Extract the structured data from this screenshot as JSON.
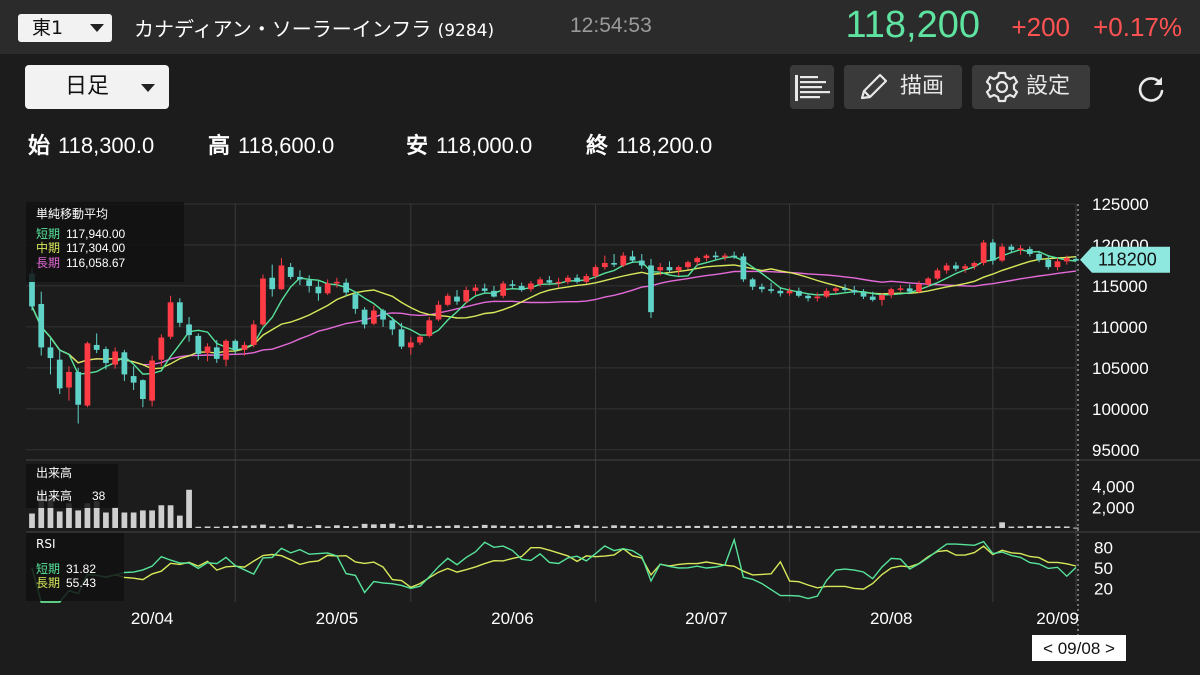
{
  "header": {
    "market": "東1",
    "stock_name": "カナディアン・ソーラーインフラ",
    "stock_code": "(9284)",
    "time": "12:54:53",
    "price": "118,200",
    "change": "+200",
    "change_pct": "+0.17%"
  },
  "toolbar": {
    "period": "日足",
    "draw_label": "描画",
    "settings_label": "設定",
    "icons": [
      "list-icon",
      "pencil-icon",
      "gear-icon",
      "refresh-icon"
    ]
  },
  "ohlc": {
    "open_label": "始",
    "open": "118,300.0",
    "high_label": "高",
    "high": "118,600.0",
    "low_label": "安",
    "low": "118,000.0",
    "close_label": "終",
    "close": "118,200.0"
  },
  "colors": {
    "up": "#ff3b46",
    "down": "#5fd3c8",
    "ma_short": "#56e39a",
    "ma_mid": "#d7e85a",
    "ma_long": "#e36ad8",
    "rsi_short": "#56e39a",
    "rsi_long": "#d7e85a",
    "price_tag": "#8fe8e0"
  },
  "chart_data": {
    "type": "candlestick",
    "price_panel": {
      "title": "単純移動平均",
      "legend": [
        {
          "name": "短期",
          "value": "117,940.00"
        },
        {
          "name": "中期",
          "value": "117,304.00"
        },
        {
          "name": "長期",
          "value": "116,058.67"
        }
      ],
      "y_ticks": [
        95000,
        100000,
        105000,
        110000,
        115000,
        120000,
        125000
      ],
      "ylim": [
        94000,
        125000
      ],
      "current_price": "118200",
      "candles_ohlc": [
        [
          116500,
          117200,
          112000,
          112500
        ],
        [
          112800,
          114300,
          106500,
          107500
        ],
        [
          107500,
          108600,
          104200,
          106200
        ],
        [
          106000,
          107300,
          101800,
          102500
        ],
        [
          102600,
          105200,
          101000,
          104500
        ],
        [
          104500,
          105000,
          98200,
          100500
        ],
        [
          100400,
          108200,
          100200,
          108000
        ],
        [
          107800,
          109200,
          106800,
          107200
        ],
        [
          107300,
          107600,
          104800,
          105600
        ],
        [
          105400,
          107500,
          104900,
          107000
        ],
        [
          106900,
          107200,
          103400,
          104200
        ],
        [
          104000,
          105200,
          102300,
          103200
        ],
        [
          103500,
          103600,
          100200,
          101200
        ],
        [
          101000,
          106500,
          100300,
          105900
        ],
        [
          106000,
          109100,
          105200,
          108700
        ],
        [
          108800,
          113800,
          108500,
          113000
        ],
        [
          113000,
          113500,
          110000,
          110500
        ],
        [
          110300,
          111200,
          108200,
          109000
        ],
        [
          108900,
          109200,
          106000,
          106700
        ],
        [
          106800,
          108000,
          105800,
          107600
        ],
        [
          107500,
          108400,
          105600,
          106100
        ],
        [
          106000,
          108500,
          105200,
          108300
        ],
        [
          108300,
          108500,
          106700,
          107200
        ],
        [
          107200,
          108200,
          106500,
          107800
        ],
        [
          107800,
          110800,
          107500,
          110300
        ],
        [
          110300,
          116400,
          110100,
          115900
        ],
        [
          116000,
          117600,
          113700,
          114600
        ],
        [
          114600,
          118400,
          114500,
          117500
        ],
        [
          117300,
          117800,
          115800,
          116100
        ],
        [
          116100,
          116900,
          115100,
          115800
        ],
        [
          115700,
          116300,
          114200,
          115000
        ],
        [
          114900,
          115600,
          113200,
          114100
        ],
        [
          114100,
          115800,
          113900,
          115300
        ],
        [
          115300,
          116000,
          114800,
          115500
        ],
        [
          115400,
          115900,
          113700,
          114200
        ],
        [
          114000,
          114300,
          111600,
          112200
        ],
        [
          112100,
          112400,
          109800,
          110300
        ],
        [
          110400,
          112600,
          110200,
          112000
        ],
        [
          112000,
          112200,
          110000,
          110900
        ],
        [
          110800,
          111200,
          109000,
          109700
        ],
        [
          109700,
          110500,
          107300,
          107600
        ],
        [
          107500,
          108800,
          106600,
          108100
        ],
        [
          108100,
          109000,
          107800,
          108800
        ],
        [
          108900,
          111200,
          108700,
          110800
        ],
        [
          110900,
          113200,
          110700,
          112700
        ],
        [
          112700,
          114100,
          112500,
          113800
        ],
        [
          113700,
          114500,
          112700,
          113100
        ],
        [
          113100,
          114900,
          112900,
          114500
        ],
        [
          114400,
          115200,
          113900,
          114800
        ],
        [
          114700,
          115300,
          114100,
          114400
        ],
        [
          114400,
          115000,
          113600,
          113700
        ],
        [
          113800,
          115600,
          113500,
          115300
        ],
        [
          115200,
          115700,
          114600,
          115100
        ],
        [
          115000,
          115400,
          114300,
          114500
        ],
        [
          114600,
          115600,
          114300,
          115300
        ],
        [
          115200,
          116100,
          114900,
          115800
        ],
        [
          115700,
          116200,
          115100,
          115400
        ],
        [
          115400,
          116000,
          114800,
          115500
        ],
        [
          115500,
          116300,
          115200,
          116000
        ],
        [
          116000,
          116400,
          115300,
          115500
        ],
        [
          115500,
          116500,
          115300,
          116200
        ],
        [
          116200,
          117600,
          115900,
          117300
        ],
        [
          117300,
          118700,
          117000,
          117800
        ],
        [
          117800,
          118900,
          117300,
          117600
        ],
        [
          117500,
          119100,
          117300,
          118700
        ],
        [
          118600,
          119300,
          117800,
          118100
        ],
        [
          118100,
          118900,
          117100,
          117500
        ],
        [
          117500,
          118300,
          111100,
          111800
        ],
        [
          116900,
          117800,
          116300,
          117300
        ],
        [
          117300,
          118000,
          116600,
          116900
        ],
        [
          116900,
          117500,
          116200,
          117300
        ],
        [
          117300,
          118100,
          117000,
          117900
        ],
        [
          117900,
          118600,
          117500,
          118400
        ],
        [
          118400,
          118900,
          118000,
          118700
        ],
        [
          118700,
          119200,
          118200,
          118500
        ],
        [
          118500,
          119000,
          118100,
          118700
        ],
        [
          118700,
          119200,
          118300,
          118600
        ],
        [
          118600,
          119000,
          115500,
          115800
        ],
        [
          115800,
          116000,
          114500,
          114900
        ],
        [
          114900,
          115300,
          114200,
          114600
        ],
        [
          114600,
          115400,
          114100,
          114400
        ],
        [
          114400,
          114800,
          113700,
          114100
        ],
        [
          114100,
          114800,
          113800,
          114400
        ],
        [
          114400,
          114800,
          113600,
          113800
        ],
        [
          113800,
          114100,
          113100,
          113500
        ],
        [
          113500,
          114200,
          113100,
          113700
        ],
        [
          113700,
          114700,
          113500,
          114400
        ],
        [
          114400,
          114900,
          114100,
          114700
        ],
        [
          114700,
          115200,
          114300,
          114500
        ],
        [
          114500,
          115000,
          113900,
          114200
        ],
        [
          114200,
          114600,
          113400,
          113700
        ],
        [
          113700,
          114300,
          113100,
          113300
        ],
        [
          113300,
          114100,
          112600,
          113900
        ],
        [
          113900,
          114800,
          113500,
          114600
        ],
        [
          114600,
          115100,
          114300,
          114700
        ],
        [
          114700,
          115200,
          114000,
          114300
        ],
        [
          114300,
          115600,
          114100,
          115200
        ],
        [
          115200,
          116100,
          114900,
          115900
        ],
        [
          115900,
          117200,
          115700,
          116900
        ],
        [
          116900,
          117800,
          116500,
          117500
        ],
        [
          117500,
          117900,
          116800,
          117100
        ],
        [
          117100,
          117700,
          116600,
          117400
        ],
        [
          117400,
          118000,
          117000,
          117800
        ],
        [
          117800,
          120600,
          117500,
          120300
        ],
        [
          120300,
          120700,
          117600,
          118100
        ],
        [
          118100,
          120200,
          117900,
          119800
        ],
        [
          119800,
          120100,
          119000,
          119400
        ],
        [
          119400,
          120000,
          118800,
          119600
        ],
        [
          119500,
          119800,
          118600,
          118900
        ],
        [
          118900,
          119300,
          117900,
          118200
        ],
        [
          118200,
          118600,
          117000,
          117300
        ],
        [
          117300,
          118400,
          116900,
          118000
        ],
        [
          118000,
          118700,
          117600,
          118400
        ],
        [
          118300,
          118600,
          118000,
          118200
        ]
      ]
    },
    "volume_panel": {
      "title": "出来高",
      "legend": [
        {
          "name": "出来高",
          "value": "38"
        }
      ],
      "y_ticks": [
        "4,000",
        "2,000"
      ],
      "y_tick_values": [
        4000,
        2000
      ],
      "ylim": [
        0,
        6000
      ],
      "values": [
        1400,
        3600,
        2900,
        1600,
        2400,
        1700,
        2400,
        2600,
        1500,
        2000,
        1500,
        1500,
        1700,
        1700,
        2200,
        2200,
        1200,
        3700,
        120,
        150,
        130,
        180,
        200,
        230,
        250,
        330,
        160,
        160,
        350,
        180,
        130,
        280,
        150,
        260,
        190,
        160,
        400,
        350,
        380,
        420,
        180,
        300,
        270,
        160,
        200,
        210,
        270,
        160,
        190,
        300,
        250,
        210,
        170,
        220,
        180,
        240,
        280,
        160,
        190,
        300,
        220,
        170,
        140,
        260,
        220,
        190,
        160,
        170,
        230,
        150,
        180,
        210,
        200,
        230,
        180,
        160,
        200,
        170,
        180,
        190,
        200,
        210,
        220,
        180,
        170,
        160,
        150,
        190,
        200,
        230,
        180,
        210,
        220,
        180,
        200,
        170,
        190,
        180,
        200,
        170,
        160,
        150,
        160,
        140,
        130,
        550,
        140,
        160,
        200,
        180,
        170,
        160,
        150,
        38
      ]
    },
    "rsi_panel": {
      "title": "RSI",
      "legend": [
        {
          "name": "短期",
          "value": "31.82"
        },
        {
          "name": "長期",
          "value": "55.43"
        }
      ],
      "y_ticks": [
        80,
        50,
        20
      ],
      "ylim": [
        0,
        100
      ]
    },
    "x_tick_labels": [
      "20/04",
      "20/05",
      "20/06",
      "20/07",
      "20/08",
      "20/09"
    ],
    "cursor_label": "< 09/08 >"
  }
}
